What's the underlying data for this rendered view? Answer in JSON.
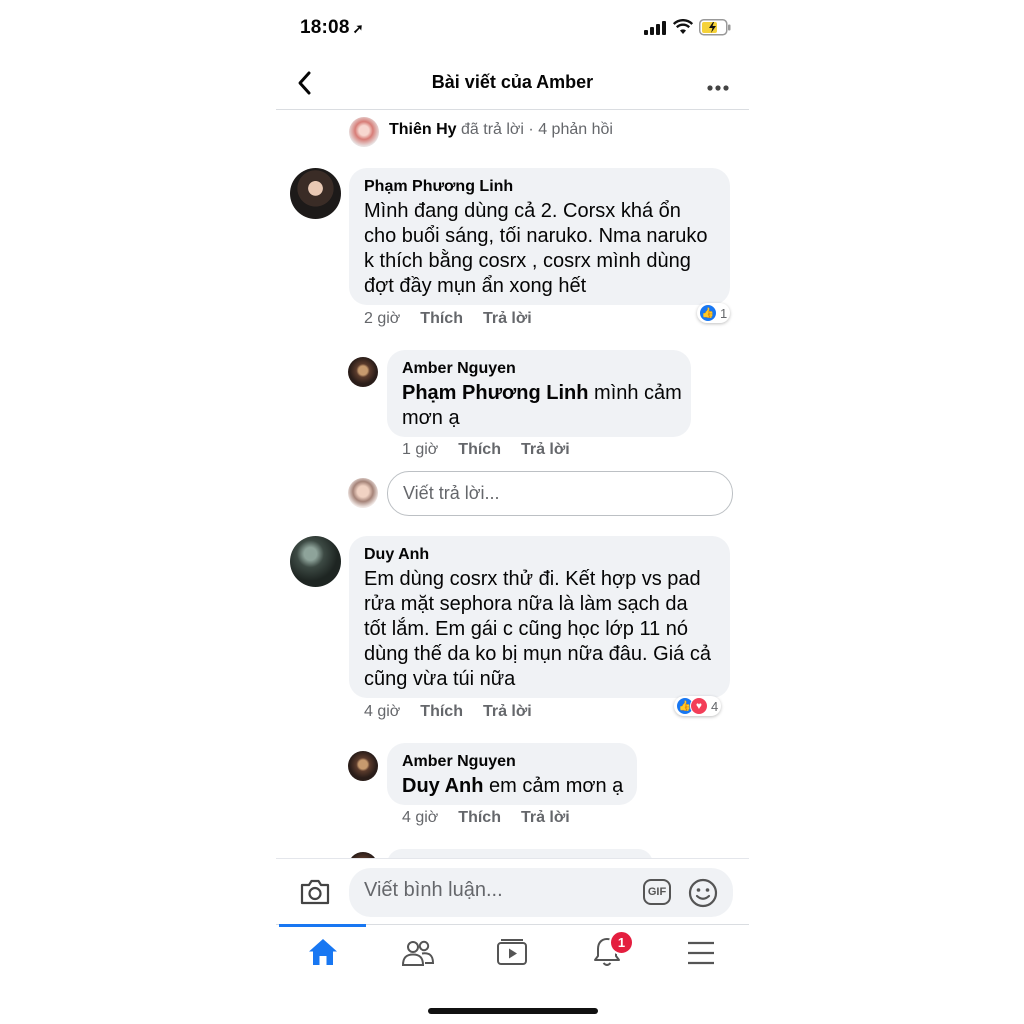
{
  "status_bar": {
    "time": "18:08",
    "location_glyph": "➚"
  },
  "header": {
    "title": "Bài viết của Amber"
  },
  "reply_summary": {
    "name": "Thiên Hy",
    "text": "đã trả lời · 4 phản hồi"
  },
  "comments": [
    {
      "name": "Phạm Phương Linh",
      "lines": [
        "Mình đang dùng cả 2. Corsx khá ổn",
        "cho buổi sáng, tối naruko. Nma naruko",
        "k thích bằng cosrx , cosrx mình dùng",
        "đợt đầy mụn ẩn xong hết"
      ],
      "time": "2 giờ",
      "like": "Thích",
      "reply": "Trả lời",
      "reaction_count": "1"
    },
    {
      "name": "Amber Nguyen",
      "mention": "Phạm Phương Linh",
      "lines": [
        " mình cảm",
        "mơn ạ"
      ],
      "time": "1 giờ",
      "like": "Thích",
      "reply": "Trả lời"
    },
    {
      "name": "Duy Anh",
      "lines": [
        "Em dùng cosrx thử đi. Kết hợp vs pad",
        "rửa mặt sephora nữa là làm sạch da",
        "tốt lắm. Em gái c cũng học lớp 11 nó",
        "dùng thế da ko bị mụn nữa đâu. Giá cả",
        "cũng vừa túi nữa"
      ],
      "time": "4 giờ",
      "like": "Thích",
      "reply": "Trả lời",
      "reaction_count": "4"
    },
    {
      "name": "Amber Nguyen",
      "mention": "Duy Anh",
      "lines": [
        " em cảm mơn ạ"
      ],
      "time": "4 giờ",
      "like": "Thích",
      "reply": "Trả lời"
    }
  ],
  "reply_input": {
    "placeholder": "Viết trả lời..."
  },
  "composer": {
    "placeholder": "Viết bình luận...",
    "gif_label": "GIF"
  },
  "tabbar": {
    "notification_badge": "1"
  },
  "colors": {
    "accent": "#1877f2",
    "bubble": "#f0f2f5",
    "badge": "#e41e3f"
  }
}
